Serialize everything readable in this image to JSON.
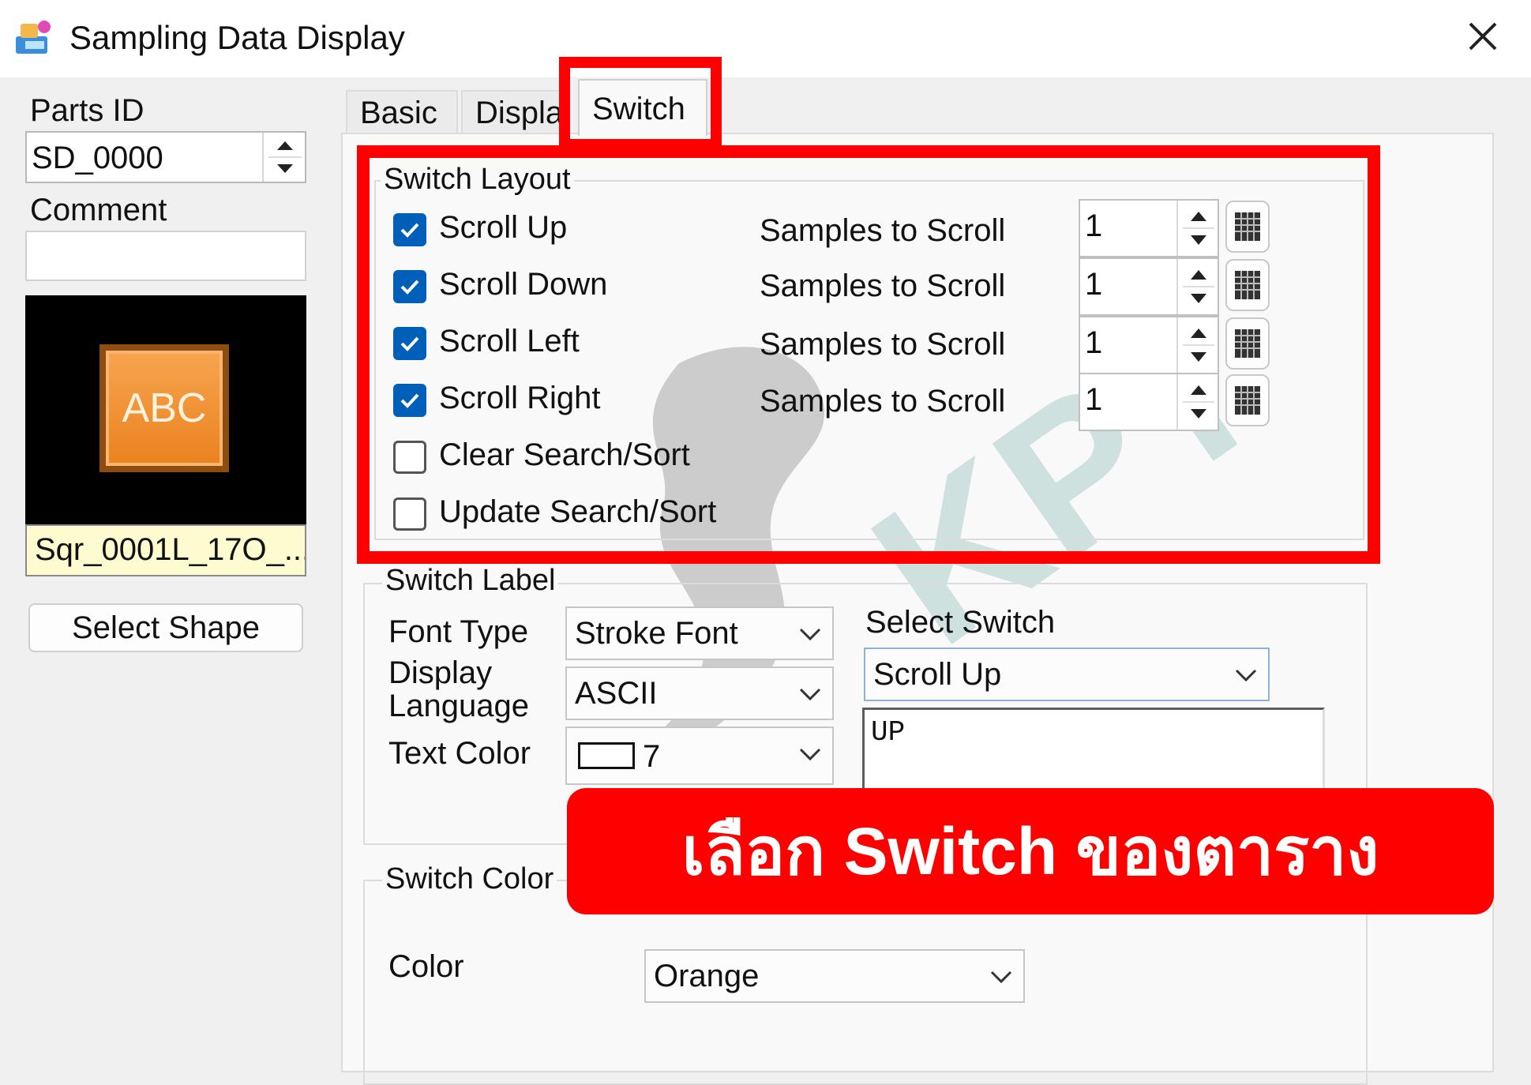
{
  "window": {
    "title": "Sampling Data Display",
    "icon": "app-icon",
    "close_icon": "close-icon"
  },
  "left_panel": {
    "parts_id_label": "Parts ID",
    "parts_id_value": "SD_0000",
    "comment_label": "Comment",
    "comment_value": "",
    "preview_text": "ABC",
    "shape_name": "Sqr_0001L_17O_...",
    "select_shape_label": "Select Shape"
  },
  "tabs": [
    {
      "label": "Basic",
      "active": false
    },
    {
      "label": "Display",
      "active": false
    },
    {
      "label": "Switch",
      "active": true
    }
  ],
  "switch_layout": {
    "title": "Switch Layout",
    "items": [
      {
        "label": "Scroll Up",
        "checked": true,
        "samples_label": "Samples to Scroll",
        "samples_value": "1"
      },
      {
        "label": "Scroll Down",
        "checked": true,
        "samples_label": "Samples to Scroll",
        "samples_value": "1"
      },
      {
        "label": "Scroll Left",
        "checked": true,
        "samples_label": "Samples to Scroll",
        "samples_value": "1"
      },
      {
        "label": "Scroll Right",
        "checked": true,
        "samples_label": "Samples to Scroll",
        "samples_value": "1"
      },
      {
        "label": "Clear Search/Sort",
        "checked": false
      },
      {
        "label": "Update Search/Sort",
        "checked": false
      }
    ]
  },
  "switch_label": {
    "title": "Switch Label",
    "font_type_label": "Font Type",
    "font_type_value": "Stroke Font",
    "display_language_label_line1": "Display",
    "display_language_label_line2": "Language",
    "display_language_value": "ASCII",
    "text_color_label": "Text Color",
    "text_color_value": "7",
    "text_color_swatch": "#ffffff",
    "select_switch_label": "Select Switch",
    "select_switch_value": "Scroll Up",
    "label_text": "UP"
  },
  "switch_color": {
    "title": "Switch Color",
    "color_label": "Color",
    "color_value": "Orange"
  },
  "annotation": {
    "banner_text": "เลือก Switch ของตาราง",
    "highlight_color": "#ff0000"
  },
  "colors": {
    "checkbox_checked": "#005fb8",
    "preview_switch": "#f39237",
    "shape_name_bg": "#fffbd0"
  }
}
